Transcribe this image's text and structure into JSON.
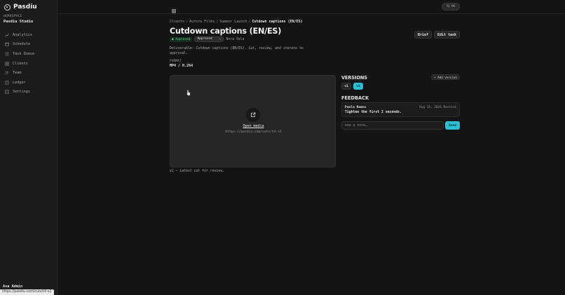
{
  "sidebar": {
    "brand": "Pasdiu",
    "workspace_label": "WORKSPACE",
    "workspace_name": "Pasdiu Studio",
    "items": [
      {
        "label": "Analytics",
        "icon": "chart-icon"
      },
      {
        "label": "Schedule",
        "icon": "calendar-icon"
      },
      {
        "label": "Task Queue",
        "icon": "list-icon"
      },
      {
        "label": "Clients",
        "icon": "grid-icon"
      },
      {
        "label": "Team",
        "icon": "users-icon"
      },
      {
        "label": "Ledger",
        "icon": "ledger-icon"
      },
      {
        "label": "Settings",
        "icon": "settings-icon"
      }
    ],
    "user": "Ava Admin"
  },
  "statusbar": {
    "url": "https://pasdiu.com/cuts/t4-v2"
  },
  "topbar": {
    "search_shortcut": "⌘K"
  },
  "breadcrumb": {
    "items": [
      "Clients",
      "Aurora Films",
      "Summer Launch"
    ],
    "current": "Cutdown captions (EN/ES)"
  },
  "task": {
    "title": "Cutdown captions (EN/ES)",
    "status_badge": "Approved",
    "status_select": "Approved",
    "assignee": "Nora Vela",
    "brief_label": "Brief",
    "edit_label": "Edit task",
    "description": "Deliverable: Cutdown captions (EN/ES). Cut, review, and iterate to approval.",
    "format_label": "FORMAT",
    "format_value": "MP4 / H.264"
  },
  "media": {
    "open_label": "Open media",
    "url": "https://pasdiu.com/cuts/t4-v2",
    "caption": "v2 — Latest cut for review."
  },
  "versions": {
    "heading": "VERSIONS",
    "add_label": "+ Add version",
    "items": [
      "v1",
      "v2"
    ],
    "selected": "v2"
  },
  "feedback": {
    "heading": "FEEDBACK",
    "comments": [
      {
        "author": "Paola Ramos",
        "meta": "Aug 15, 2026 Resolve",
        "body": "Tighten the first 2 seconds."
      }
    ],
    "note_placeholder": "Add a note…",
    "send_label": "Send"
  },
  "colors": {
    "accent": "#27c1d6",
    "approved": "#52c57a",
    "background": "#141414"
  }
}
